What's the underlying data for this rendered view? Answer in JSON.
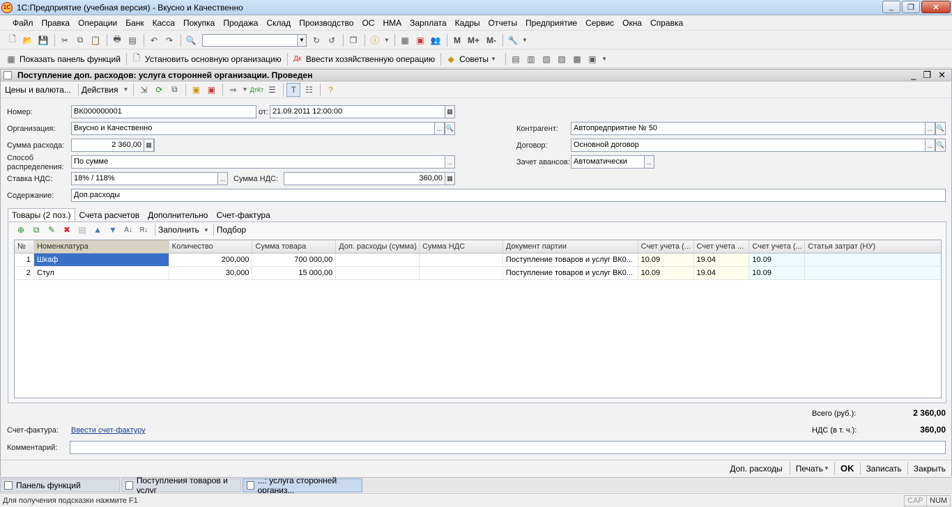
{
  "window": {
    "title": "1С:Предприятие (учебная версия) - Вкусно и Качественно",
    "logo": "1С"
  },
  "menu": [
    "Файл",
    "Правка",
    "Операции",
    "Банк",
    "Касса",
    "Покупка",
    "Продажа",
    "Склад",
    "Производство",
    "ОС",
    "НМА",
    "Зарплата",
    "Кадры",
    "Отчеты",
    "Предприятие",
    "Сервис",
    "Окна",
    "Справка"
  ],
  "toolbar1": {
    "m_labels": [
      "M",
      "M+",
      "M-"
    ]
  },
  "toolbar2": {
    "show_panel": "Показать панель функций",
    "set_org": "Установить основную организацию",
    "enter_op": "Ввести хозяйственную операцию",
    "tips": "Советы"
  },
  "document": {
    "title": "Поступление доп. расходов: услуга сторонней организации. Проведен",
    "toolbar": {
      "prices": "Цены и валюта...",
      "actions": "Действия"
    },
    "labels": {
      "number": "Номер:",
      "from": "от:",
      "org": "Организация:",
      "amount": "Сумма расхода:",
      "method_l1": "Способ",
      "method_l2": "распределения:",
      "vat_rate": "Ставка НДС:",
      "vat_sum": "Сумма НДС:",
      "content": "Содержание:",
      "contractor": "Контрагент:",
      "contract": "Договор:",
      "advances": "Зачет авансов:"
    },
    "values": {
      "number": "ВК000000001",
      "date": "21.09.2011 12:00:00",
      "org": "Вкусно и Качественно",
      "amount": "2 360,00",
      "method": "По сумме",
      "vat_rate": "18% / 118%",
      "vat_sum": "360,00",
      "content": "Доп.расходы",
      "contractor": "Автопредприятие № 50",
      "contract": "Основной договор",
      "advances": "Автоматически"
    },
    "tabs": [
      "Товары (2 поз.)",
      "Счета расчетов",
      "Дополнительно",
      "Счет-фактура"
    ],
    "table_toolbar": {
      "fill": "Заполнить",
      "pick": "Подбор"
    },
    "columns": [
      "№",
      "Номенклатура",
      "Количество",
      "Сумма товара",
      "Доп. расходы (сумма)",
      "Сумма НДС",
      "Документ партии",
      "Счет учета (...",
      "Счет учета ...",
      "Счет учета (...",
      "Статья затрат (НУ)"
    ],
    "rows": [
      {
        "n": "1",
        "name": "Шкаф",
        "qty": "200,000",
        "sum": "700 000,00",
        "extra": "",
        "vat": "",
        "doc": "Поступление товаров и услуг ВК0...",
        "acc1": "10.09",
        "acc2": "19.04",
        "acc3": "10.09",
        "cost": ""
      },
      {
        "n": "2",
        "name": "Стул",
        "qty": "30,000",
        "sum": "15 000,00",
        "extra": "",
        "vat": "",
        "doc": "Поступление товаров и услуг ВК0...",
        "acc1": "10.09",
        "acc2": "19.04",
        "acc3": "10.09",
        "cost": ""
      }
    ],
    "totals": {
      "total_label": "Всего (руб.):",
      "total": "2 360,00",
      "vat_label": "НДС (в т. ч.):",
      "vat": "360,00"
    },
    "invoice": {
      "label": "Счет-фактура:",
      "link": "Ввести счет-фактуру"
    },
    "comment_label": "Комментарий:",
    "bottom": {
      "extra": "Доп. расходы",
      "print": "Печать",
      "ok": "OK",
      "save": "Записать",
      "close": "Закрыть"
    }
  },
  "taskbar": [
    "Панель функций",
    "Поступления товаров и услуг",
    "...: услуга сторонней организ..."
  ],
  "status": {
    "hint": "Для получения подсказки нажмите F1",
    "cap": "CAP",
    "num": "NUM"
  }
}
